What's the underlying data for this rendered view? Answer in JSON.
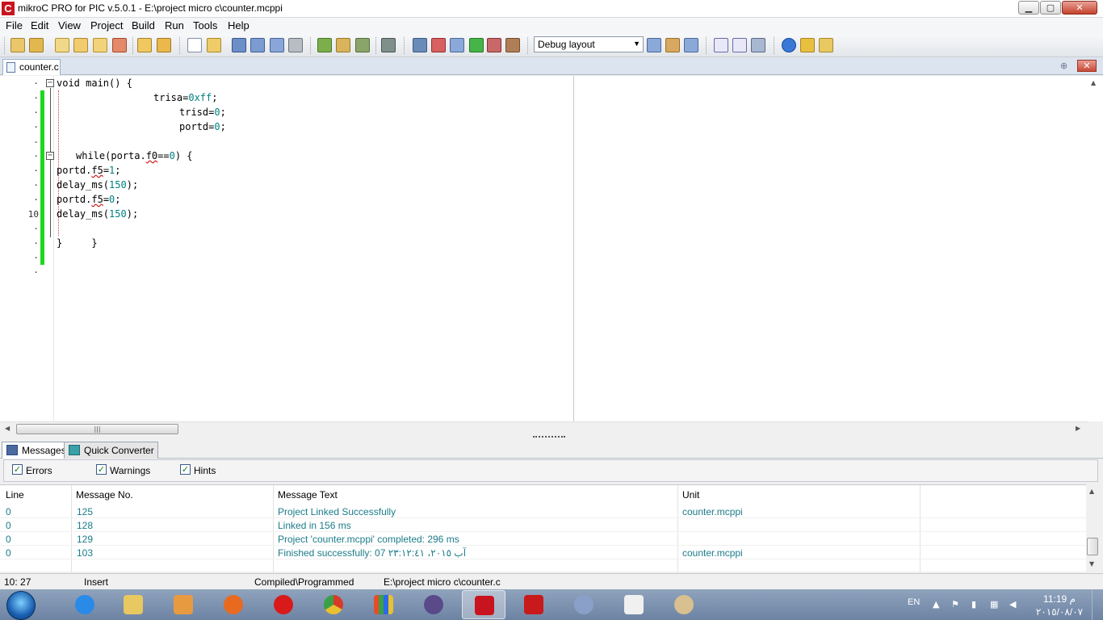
{
  "window": {
    "title": "mikroC PRO for PIC v.5.0.1 - E:\\project micro c\\counter.mcppi",
    "icon_letter": "C",
    "buttons": {
      "minimize": "▁",
      "maximize": "▢",
      "close": "✕"
    }
  },
  "menu": [
    "File",
    "Edit",
    "View",
    "Project",
    "Build",
    "Run",
    "Tools",
    "Help"
  ],
  "toolbar": {
    "layout_select": "Debug layout",
    "icons": [
      "new-project-icon",
      "open-project-icon",
      "save-project-icon",
      "close-project-icon",
      "add-file-icon",
      "remove-file-icon",
      "new-file-icon",
      "open-file-icon",
      "save-file-icon",
      "save-all-icon",
      "save-as-icon",
      "print-icon",
      "build-icon",
      "build-all-icon",
      "build-program-icon",
      "programmer-icon",
      "statistics-icon",
      "ascii-chart-icon",
      "seven-segment-icon",
      "lcd-designer-icon",
      "usb-hid-icon",
      "tools-icon",
      "save-layout-icon",
      "delete-layout-icon",
      "default-layout-icon",
      "mikroc-help-icon",
      "pic-help-icon",
      "project-settings-icon",
      "help-icon",
      "key-icon",
      "update-icon"
    ]
  },
  "editor": {
    "tab_label": "counter.c",
    "line_number_10": "10",
    "code": {
      "line1": "void main() {",
      "line2": "trisa=",
      "line2_val": "0xff",
      "line3": "trisd=",
      "line3_val": "0",
      "line4": "portd=",
      "line4_val": "0",
      "line6": "while(porta.",
      "line6_f": "f0",
      "line6_end": "==",
      "line6_val": "0",
      "line6_close": ") {",
      "line7": "portd.",
      "line7_f": "f5",
      "line7_eq": "=",
      "line7_val": "1",
      "line8": "delay_ms(",
      "line8_val": "150",
      "line9": "portd.",
      "line9_f": "f5",
      "line9_eq": "=",
      "line9_val": "0",
      "line10": "delay_ms(",
      "line10_val": "150",
      "line12": "}     }",
      "semicolon": ";",
      "close_paren": ");"
    }
  },
  "panel": {
    "tabs": [
      "Messages",
      "Quick Converter"
    ],
    "filters": [
      {
        "label": "Errors",
        "checked": true
      },
      {
        "label": "Warnings",
        "checked": true
      },
      {
        "label": "Hints",
        "checked": true
      }
    ],
    "columns": [
      "Line",
      "Message No.",
      "Message Text",
      "Unit"
    ],
    "rows": [
      {
        "line": "0",
        "no": "125",
        "text": "Project Linked Successfully",
        "unit": "counter.mcppi"
      },
      {
        "line": "0",
        "no": "128",
        "text": "Linked in 156 ms",
        "unit": ""
      },
      {
        "line": "0",
        "no": "129",
        "text": "Project 'counter.mcppi' completed: 296 ms",
        "unit": ""
      },
      {
        "line": "0",
        "no": "103",
        "text": "Finished successfully: 07 آب ٢٠١٥، ٢٣:١٢:٤١",
        "unit": "counter.mcppi"
      }
    ]
  },
  "status": {
    "position": "10: 27",
    "mode": "Insert",
    "state": "Compiled\\Programmed",
    "file": "E:\\project micro c\\counter.c"
  },
  "taskbar": {
    "apps": [
      "internet-explorer",
      "file-explorer",
      "media-player",
      "firefox",
      "opera",
      "chrome",
      "app-grid",
      "media-app",
      "mikroc",
      "acrobat",
      "network-app",
      "notepad-app",
      "paint"
    ],
    "lang": "EN",
    "time": "11:19 م",
    "date": "٢٠١٥/٠٨/٠٧"
  },
  "colors": {
    "accent_red": "#c8141e",
    "message_text": "#1c7c8a",
    "green_bar": "#1ed81e"
  }
}
